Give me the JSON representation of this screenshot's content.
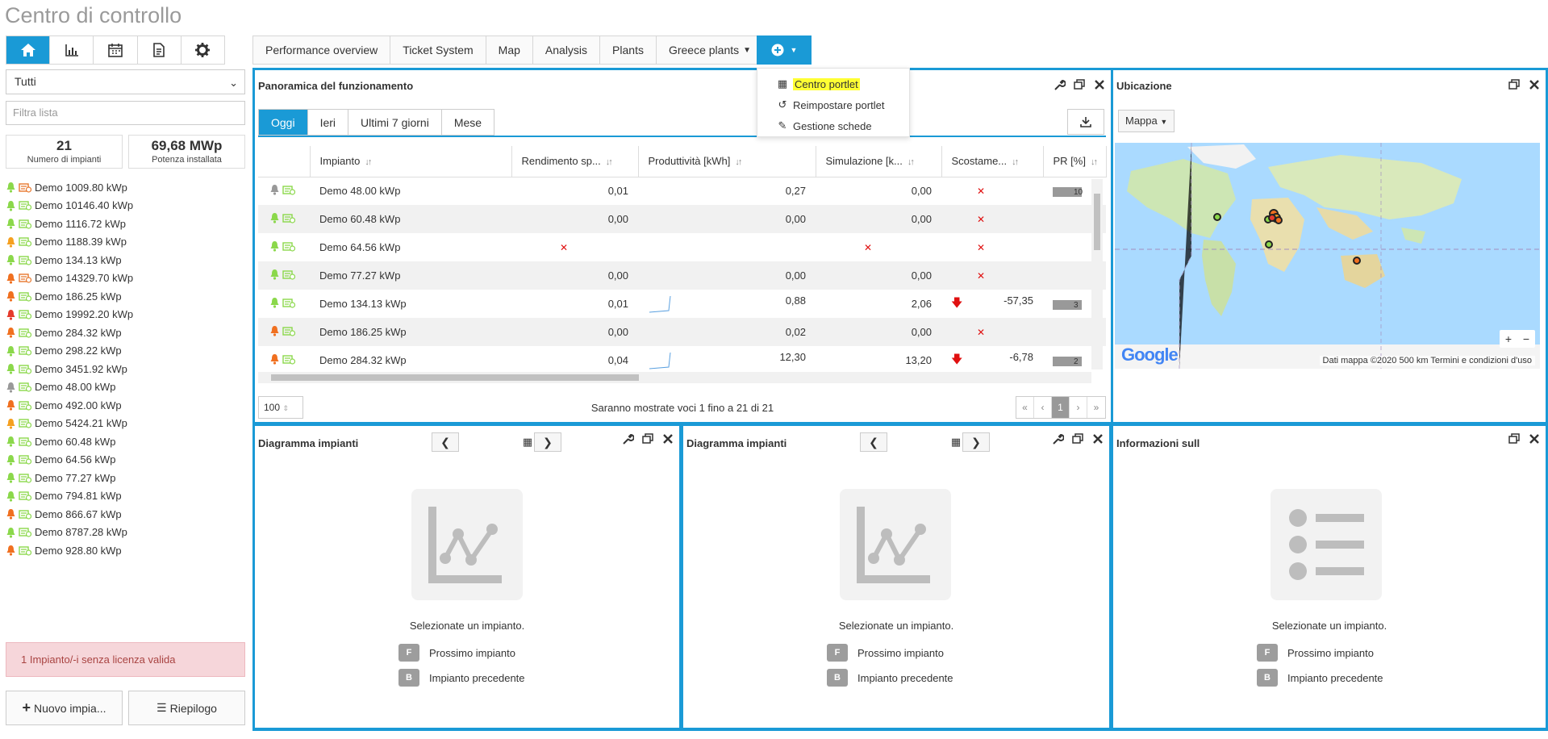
{
  "app_title": "Centro di controllo",
  "sidebar": {
    "icons": [
      "home-icon",
      "bar-chart-icon",
      "calendar-icon",
      "document-icon",
      "gear-icon"
    ],
    "filter_select": "Tutti",
    "filter_placeholder": "Filtra lista",
    "stats": [
      {
        "value": "21",
        "label": "Numero di impianti"
      },
      {
        "value": "69,68 MWp",
        "label": "Potenza installata"
      }
    ],
    "plants": [
      {
        "name": "Demo 1009.80 kWp",
        "bell": "#8bd84b",
        "inv": "#e8782e"
      },
      {
        "name": "Demo 10146.40 kWp",
        "bell": "#8bd84b",
        "inv": "#8bd84b"
      },
      {
        "name": "Demo 1116.72 kWp",
        "bell": "#8bd84b",
        "inv": "#8bd84b"
      },
      {
        "name": "Demo 1188.39 kWp",
        "bell": "#f5a020",
        "inv": "#8bd84b"
      },
      {
        "name": "Demo 134.13 kWp",
        "bell": "#8bd84b",
        "inv": "#8bd84b"
      },
      {
        "name": "Demo 14329.70 kWp",
        "bell": "#f07020",
        "inv": "#e8782e"
      },
      {
        "name": "Demo 186.25 kWp",
        "bell": "#f07020",
        "inv": "#8bd84b"
      },
      {
        "name": "Demo 19992.20 kWp",
        "bell": "#e53b2c",
        "inv": "#8bd84b"
      },
      {
        "name": "Demo 284.32 kWp",
        "bell": "#f07020",
        "inv": "#8bd84b"
      },
      {
        "name": "Demo 298.22 kWp",
        "bell": "#8bd84b",
        "inv": "#8bd84b"
      },
      {
        "name": "Demo 3451.92 kWp",
        "bell": "#8bd84b",
        "inv": "#8bd84b"
      },
      {
        "name": "Demo 48.00 kWp",
        "bell": "#999999",
        "inv": "#8bd84b"
      },
      {
        "name": "Demo 492.00 kWp",
        "bell": "#f07020",
        "inv": "#8bd84b"
      },
      {
        "name": "Demo 5424.21 kWp",
        "bell": "#f5a020",
        "inv": "#8bd84b"
      },
      {
        "name": "Demo 60.48 kWp",
        "bell": "#8bd84b",
        "inv": "#8bd84b"
      },
      {
        "name": "Demo 64.56 kWp",
        "bell": "#8bd84b",
        "inv": "#8bd84b"
      },
      {
        "name": "Demo 77.27 kWp",
        "bell": "#8bd84b",
        "inv": "#8bd84b"
      },
      {
        "name": "Demo 794.81 kWp",
        "bell": "#8bd84b",
        "inv": "#8bd84b"
      },
      {
        "name": "Demo 866.67 kWp",
        "bell": "#f07020",
        "inv": "#8bd84b"
      },
      {
        "name": "Demo 8787.28 kWp",
        "bell": "#8bd84b",
        "inv": "#8bd84b"
      },
      {
        "name": "Demo 928.80 kWp",
        "bell": "#f07020",
        "inv": "#8bd84b"
      }
    ],
    "warning": "1 Impianto/-i senza licenza valida",
    "new_plant_btn": "Nuovo impia...",
    "summary_btn": "Riepilogo"
  },
  "tabs": [
    "Performance overview",
    "Ticket System",
    "Map",
    "Analysis",
    "Plants",
    "Greece plants"
  ],
  "add_menu": {
    "items": [
      {
        "label": "Centro portlet",
        "icon": "grid-icon"
      },
      {
        "label": "Reimpostare portlet",
        "icon": "reset-icon"
      },
      {
        "label": "Gestione schede",
        "icon": "edit-icon"
      }
    ]
  },
  "overview": {
    "title": "Panoramica del funzionamento",
    "periods": [
      "Oggi",
      "Ieri",
      "Ultimi 7 giorni",
      "Mese"
    ],
    "columns": [
      "Impianto",
      "Rendimento sp...",
      "Produttività [kWh]",
      "Simulazione [k...",
      "Scostame...",
      "PR [%]"
    ],
    "rows": [
      {
        "name": "Demo 48.00 kWp",
        "bell": "#999999",
        "rend": "0,01",
        "prod": "0,27",
        "sim": "0,00",
        "dev": "",
        "devx": true,
        "pr": "10",
        "pr_fill": 0.9
      },
      {
        "name": "Demo 60.48 kWp",
        "bell": "#8bd84b",
        "rend": "0,00",
        "prod": "0,00",
        "sim": "0,00",
        "dev": "",
        "devx": true,
        "pr": "",
        "pr_fill": 0
      },
      {
        "name": "Demo 64.56 kWp",
        "bell": "#8bd84b",
        "rend": "",
        "rendx": true,
        "prod": "",
        "simx": true,
        "sim": "",
        "dev": "",
        "devx": true,
        "pr": "",
        "pr_fill": 0
      },
      {
        "name": "Demo 77.27 kWp",
        "bell": "#8bd84b",
        "rend": "0,00",
        "prod": "0,00",
        "sim": "0,00",
        "dev": "",
        "devx": true,
        "pr": "",
        "pr_fill": 0
      },
      {
        "name": "Demo 134.13 kWp",
        "bell": "#8bd84b",
        "rend": "0,01",
        "prod": "0,88",
        "sim": "2,06",
        "dev": "-57,35",
        "devdown": true,
        "pr": "3",
        "pr_fill": 0.9,
        "spark": true
      },
      {
        "name": "Demo 186.25 kWp",
        "bell": "#f07020",
        "rend": "0,00",
        "prod": "0,02",
        "sim": "0,00",
        "dev": "",
        "devx": true,
        "pr": "",
        "pr_fill": 0
      },
      {
        "name": "Demo 284.32 kWp",
        "bell": "#f07020",
        "rend": "0,04",
        "prod": "12,30",
        "sim": "13,20",
        "dev": "-6,78",
        "devdown": true,
        "pr": "2",
        "pr_fill": 0.9,
        "spark": true
      }
    ],
    "page_size": "100",
    "page_info": "Saranno mostrate voci 1 fino a 21 di 21",
    "pager": [
      "«",
      "‹",
      "1",
      "›",
      "»"
    ]
  },
  "location": {
    "title": "Ubicazione",
    "map_type": "Mappa",
    "google": "Google",
    "attribution": "Dati mappa ©2020   500 km   Termini e condizioni d'uso",
    "zoom_in": "+",
    "zoom_out": "−"
  },
  "diagram1": {
    "title": "Diagramma impianti",
    "msg": "Selezionate un impianto.",
    "next_key": "F",
    "next": "Prossimo impianto",
    "prev_key": "B",
    "prev": "Impianto precedente"
  },
  "diagram2": {
    "title": "Diagramma impianti",
    "msg": "Selezionate un impianto.",
    "next_key": "F",
    "next": "Prossimo impianto",
    "prev_key": "B",
    "prev": "Impianto precedente"
  },
  "info": {
    "title": "Informazioni sull",
    "msg": "Selezionate un impianto.",
    "next_key": "F",
    "next": "Prossimo impianto",
    "prev_key": "B",
    "prev": "Impianto precedente"
  }
}
